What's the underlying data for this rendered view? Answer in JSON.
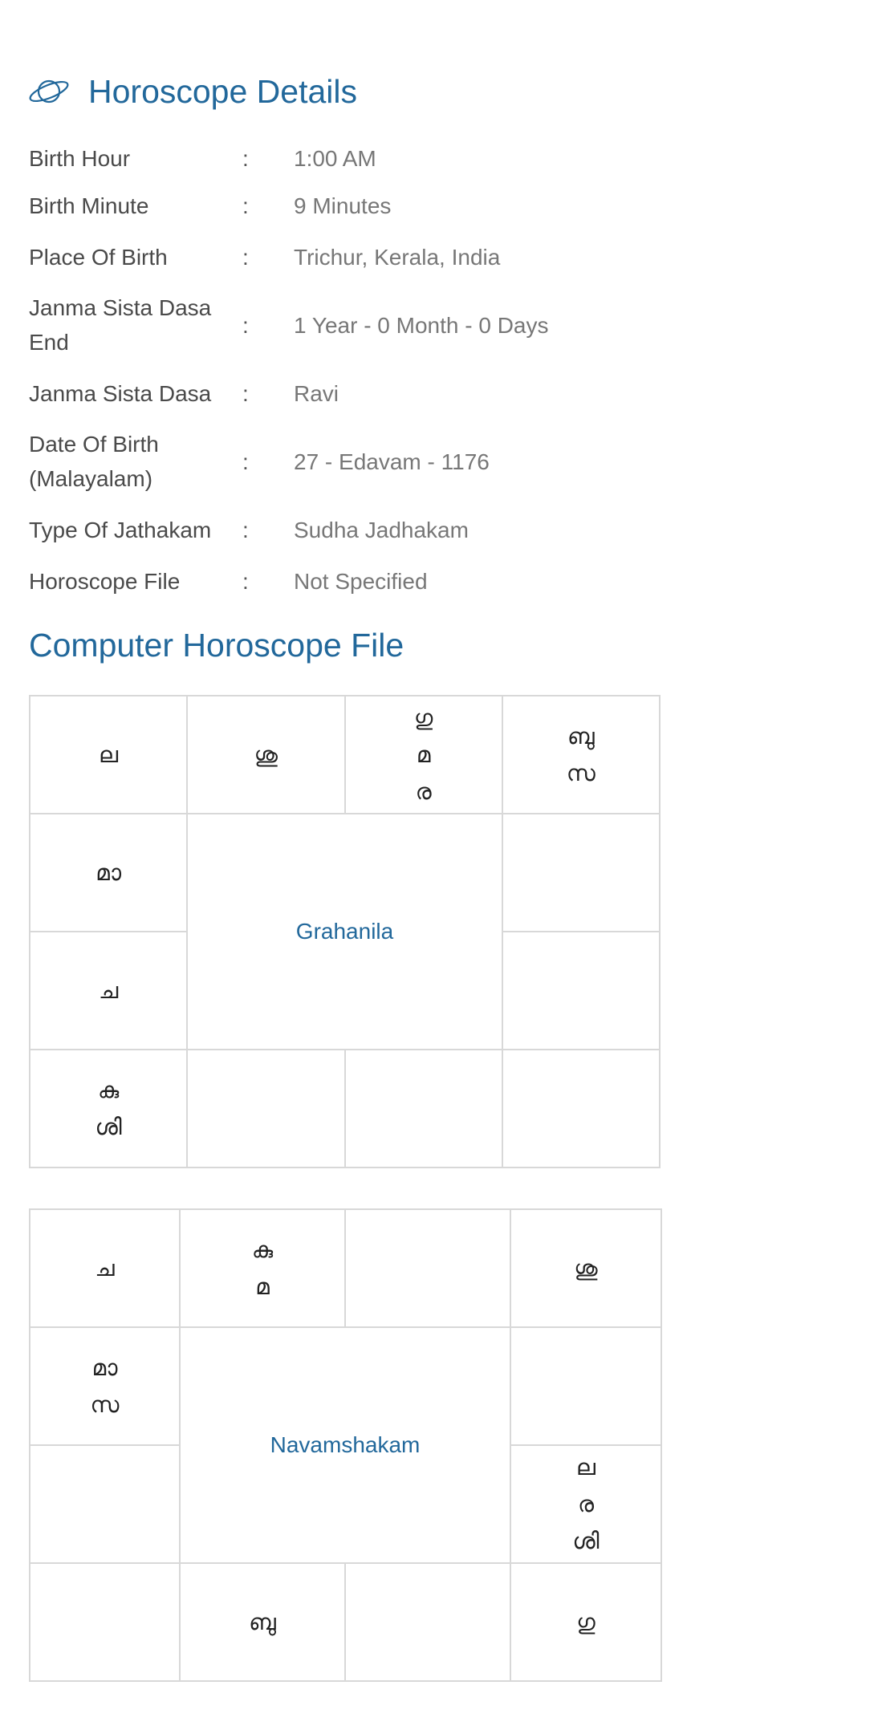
{
  "section": {
    "title": "Horoscope Details",
    "icon": "planet-icon"
  },
  "details": [
    {
      "label": "Birth Hour",
      "sep": ":",
      "value": "1:00 AM"
    },
    {
      "label": "Birth Minute",
      "sep": ":",
      "value": "9 Minutes"
    },
    {
      "label": "Place Of Birth",
      "sep": ":",
      "value": "Trichur, Kerala, India"
    },
    {
      "label": "Janma Sista Dasa End",
      "sep": ":",
      "value": "1 Year - 0 Month - 0 Days"
    },
    {
      "label": "Janma Sista Dasa",
      "sep": ":",
      "value": "Ravi"
    },
    {
      "label": "Date Of Birth (Malayalam)",
      "sep": ":",
      "value": "27 - Edavam - 1176"
    },
    {
      "label": "Type Of Jathakam",
      "sep": ":",
      "value": "Sudha Jadhakam"
    },
    {
      "label": "Horoscope File",
      "sep": ":",
      "value": "Not Specified"
    }
  ],
  "computer_horoscope": {
    "title": "Computer Horoscope File"
  },
  "grahanila": {
    "center_label": "Grahanila",
    "cells": {
      "r1c1": "ല",
      "r1c2": "ശു",
      "r1c3": "ഗു\nമ\nര",
      "r1c4": "ബു\nസ",
      "r2c1": "മാ",
      "r2c4": "",
      "r3c1": "ച",
      "r3c4": "",
      "r4c1": "കു\nശി",
      "r4c2": "",
      "r4c3": "",
      "r4c4": ""
    }
  },
  "navamshakam": {
    "center_label": "Navamshakam",
    "cells": {
      "r1c1": "ച",
      "r1c2": "കു\nമ",
      "r1c3": "",
      "r1c4": "ശു",
      "r2c1": "മാ\nസ",
      "r2c4": "",
      "r3c1": "",
      "r3c4": "ല\nര\nശി",
      "r4c1": "",
      "r4c2": "ബു",
      "r4c3": "",
      "r4c4": "ഗു"
    }
  },
  "colors": {
    "accent": "#22689b",
    "label": "#4a4a4a",
    "value": "#777777",
    "grid": "#d8d8d8"
  }
}
